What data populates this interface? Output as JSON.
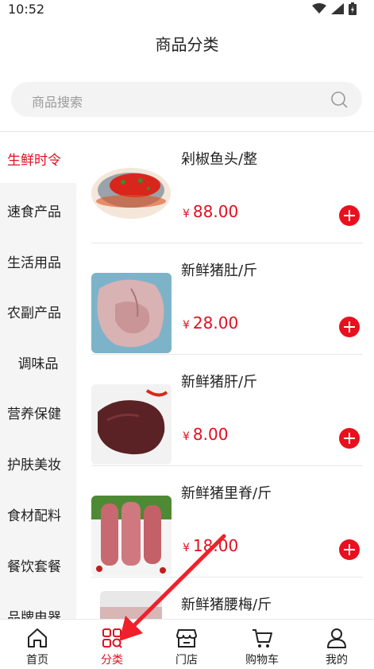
{
  "status_bar": {
    "time": "10:52"
  },
  "header": {
    "title": "商品分类"
  },
  "search": {
    "placeholder": "商品搜索"
  },
  "categories": [
    {
      "label": "生鲜时令",
      "active": true
    },
    {
      "label": "速食产品"
    },
    {
      "label": "生活用品"
    },
    {
      "label": "农副产品"
    },
    {
      "label": "调味品"
    },
    {
      "label": "营养保健"
    },
    {
      "label": "护肤美妆"
    },
    {
      "label": "食材配料"
    },
    {
      "label": "餐饮套餐"
    },
    {
      "label": "品牌电器"
    }
  ],
  "products": [
    {
      "name": "剁椒鱼头/整",
      "currency": "¥",
      "price": "88.00"
    },
    {
      "name": "新鲜猪肚/斤",
      "currency": "¥",
      "price": "28.00"
    },
    {
      "name": "新鲜猪肝/斤",
      "currency": "¥",
      "price": "8.00"
    },
    {
      "name": "新鲜猪里脊/斤",
      "currency": "¥",
      "price": "18.00"
    },
    {
      "name": "新鲜猪腰梅/斤",
      "currency": "¥",
      "price": ""
    }
  ],
  "tabbar": [
    {
      "label": "首页"
    },
    {
      "label": "分类",
      "active": true
    },
    {
      "label": "门店"
    },
    {
      "label": "购物车"
    },
    {
      "label": "我的"
    }
  ],
  "colors": {
    "accent": "#e01020",
    "sidebar_bg": "#f5f5f5"
  }
}
